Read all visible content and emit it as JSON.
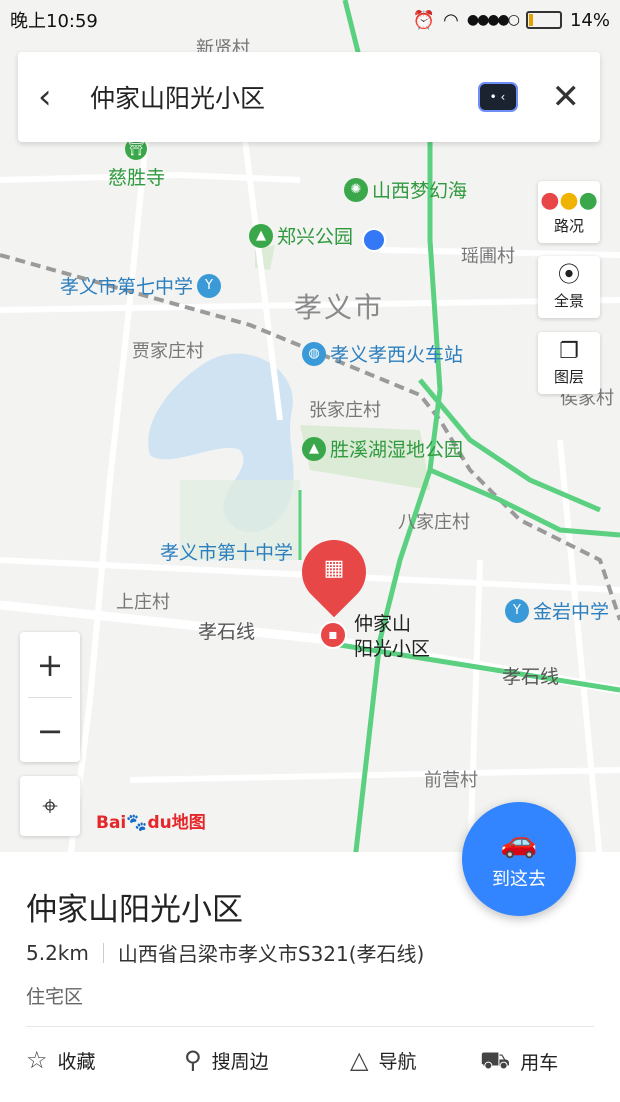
{
  "status_bar": {
    "time": "晚上10:59",
    "battery": "14%"
  },
  "search": {
    "query": "仲家山阳光小区"
  },
  "map": {
    "city_label": "孝义市",
    "villages": [
      "新贤村",
      "瑶圃村",
      "贾家庄村",
      "张家庄村",
      "八家庄村",
      "上庄村",
      "前营村",
      "侯家村"
    ],
    "roads": [
      "孝石线",
      "孝石线"
    ],
    "pois": [
      {
        "name": "慈胜寺",
        "kind": "green"
      },
      {
        "name": "山西梦幻海",
        "kind": "green"
      },
      {
        "name": "郑兴公园",
        "kind": "green"
      },
      {
        "name": "孝义市第七中学",
        "kind": "blue"
      },
      {
        "name": "孝义孝西火车站",
        "kind": "blue"
      },
      {
        "name": "胜溪湖湿地公园",
        "kind": "green"
      },
      {
        "name": "孝义市第十中学",
        "kind": "blue"
      },
      {
        "name": "金岩中学",
        "kind": "blue"
      }
    ],
    "selected_pin": {
      "line1": "仲家山",
      "line2": "阳光小区"
    }
  },
  "side_buttons": {
    "traffic": "路况",
    "panorama": "全景",
    "layers": "图层"
  },
  "zoom": {
    "in": "+",
    "out": "−"
  },
  "logo": {
    "brand_a": "Bai",
    "brand_b": "du",
    "suffix": "地图"
  },
  "go_button": {
    "label": "到这去"
  },
  "place": {
    "name": "仲家山阳光小区",
    "distance": "5.2km",
    "address": "山西省吕梁市孝义市S321(孝石线)",
    "type": "住宅区"
  },
  "actions": {
    "favorite": "收藏",
    "nearby": "搜周边",
    "navigate": "导航",
    "car": "用车"
  },
  "colors": {
    "accent": "#3385ff",
    "pin": "#e84747",
    "park": "#3aa84a",
    "school": "#3a9ad8"
  }
}
